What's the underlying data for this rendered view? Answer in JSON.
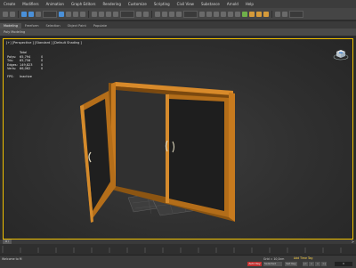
{
  "menu": [
    "Create",
    "Modifiers",
    "Animation",
    "Graph Editors",
    "Rendering",
    "Customize",
    "Scripting",
    "Civil View",
    "Substance",
    "Arnold",
    "Help"
  ],
  "ribbon_tabs": [
    "Modeling",
    "Freeform",
    "Selection",
    "Object Paint",
    "Populate"
  ],
  "sub_tab": "Poly Modeling",
  "viewport": {
    "label": "[+] [Perspective ] [Standard ] [Default Shading ]",
    "stats": {
      "header": "Total",
      "rows": [
        {
          "k": "Polys:",
          "v": "65,794",
          "t": "0"
        },
        {
          "k": "Tris:",
          "v": "65,756",
          "t": "0"
        },
        {
          "k": "Edges:",
          "v": "149,823",
          "t": "0"
        },
        {
          "k": "Verts:",
          "v": "66,062",
          "t": "0"
        }
      ],
      "fps_label": "FPS:",
      "fps_value": "Inactive"
    }
  },
  "timeslider": {
    "position": "0 / 100",
    "arrow": ">"
  },
  "status": {
    "left": "Welcome to M",
    "grid": "Grid = 10,0cm",
    "time": "Add Time Tag",
    "autokey": "Auto Key",
    "selected": "Selected",
    "setkey": "Set Key",
    "playback": [
      "|<",
      "<",
      ">",
      ">|"
    ],
    "frame": "0"
  },
  "colors": {
    "viewport_border": "#f0c000",
    "door_frame": "#c77a1e",
    "glass": "#202020"
  }
}
